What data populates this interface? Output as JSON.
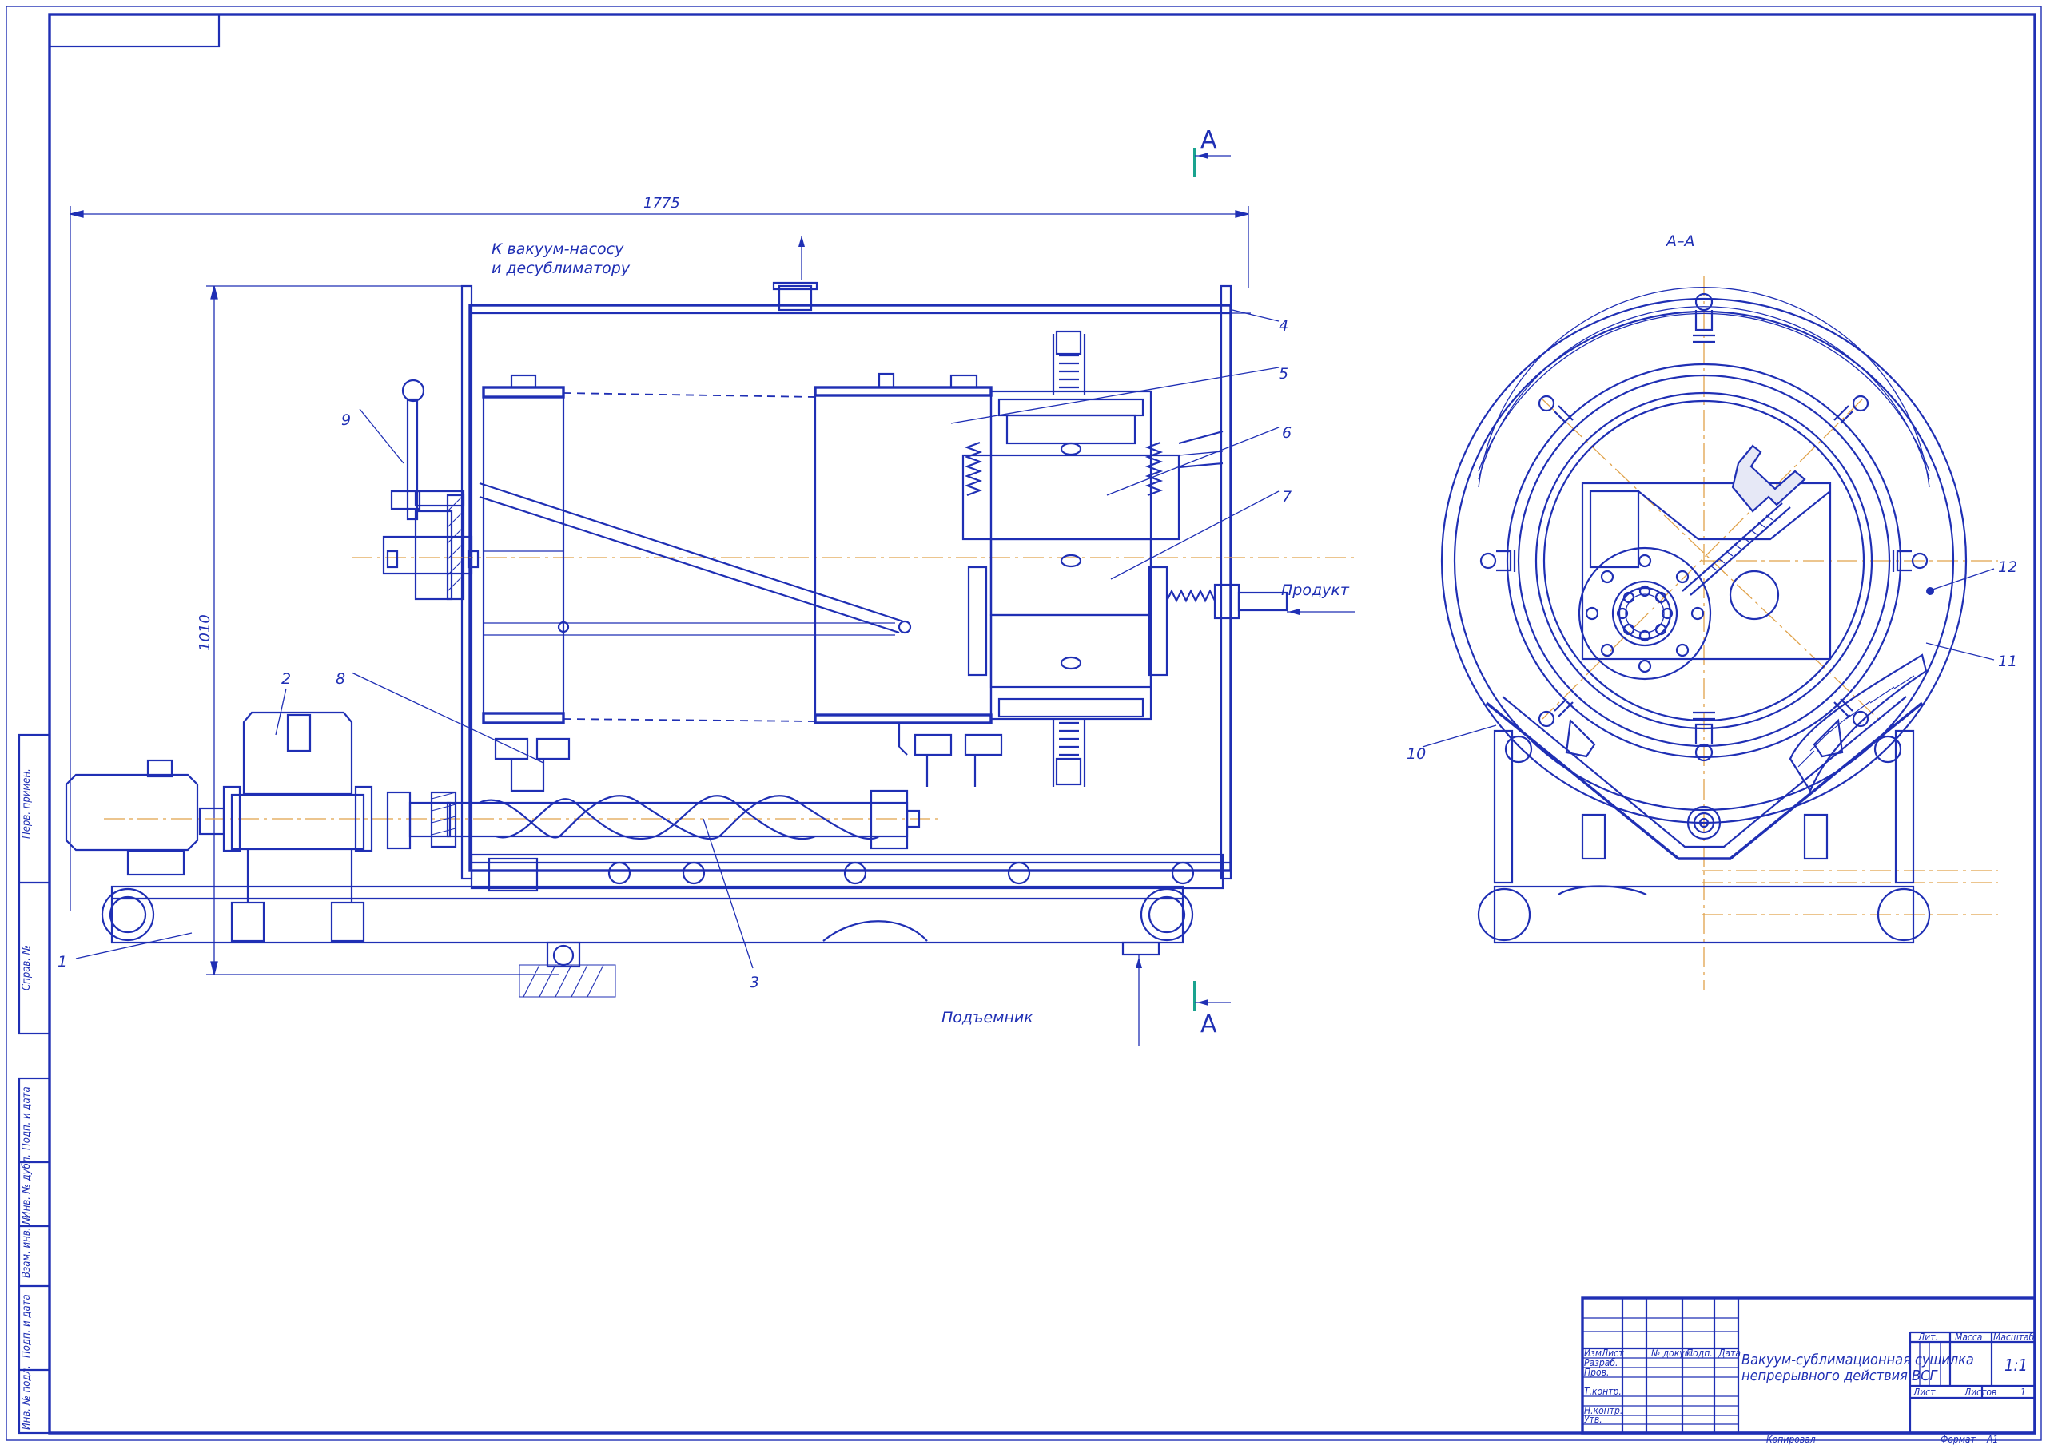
{
  "colors": {
    "line": "#1f2fb4",
    "centerline": "#e0a24a",
    "section_mark": "#1aa38f",
    "background": "#ffffff"
  },
  "drawing": {
    "dimension_length": "1775",
    "dimension_height": "1010",
    "note_vacuum": [
      "К вакуум-насосу",
      "и десублиматору"
    ],
    "label_product": "Продукт",
    "label_lift": "Подъемник",
    "section_letter": "A",
    "section_view_title": "А–А",
    "callouts": [
      "1",
      "2",
      "3",
      "4",
      "5",
      "6",
      "7",
      "8",
      "9",
      "10",
      "11",
      "12"
    ]
  },
  "side_stamp": {
    "labels": [
      "Перв. примен.",
      "Справ. №",
      "Подп. и дата",
      "Инв. № дубл.",
      "Взам. инв. №",
      "Подп. и дата",
      "Инв. № подл."
    ]
  },
  "title_block": {
    "col_headers": [
      "Изм.",
      "Лист",
      "№ докум.",
      "Подп.",
      "Дата"
    ],
    "roles": [
      "Разраб.",
      "Пров.",
      "Т.контр.",
      "Н.контр.",
      "Утв."
    ],
    "title_line1": "Вакуум-сублимационная сушилка",
    "title_line2": "непрерывного действия  ВСГ",
    "lit_label": "Лит.",
    "mass_label": "Масса",
    "scale_label": "Масштаб",
    "scale_value": "1:1",
    "sheet_label": "Лист",
    "sheets_label": "Листов",
    "sheets_value": "1",
    "copied_label": "Копировал",
    "format_label": "Формат",
    "format_value": "А1"
  }
}
